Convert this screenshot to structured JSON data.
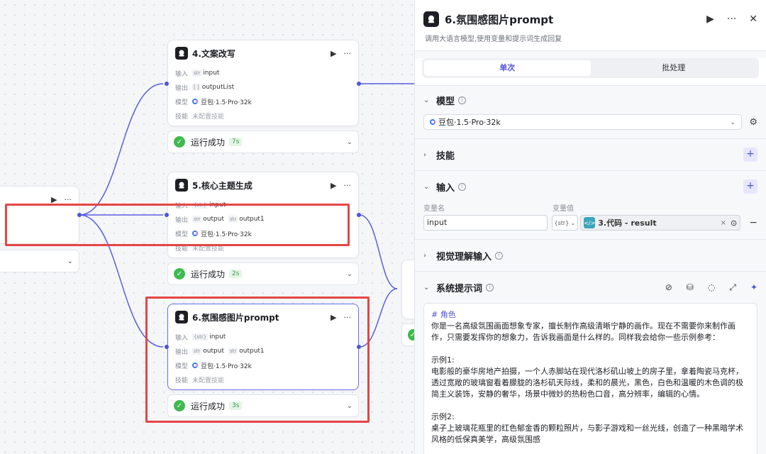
{
  "canvas": {
    "nodes": [
      {
        "id": "node4",
        "title": "4.文案改写",
        "input_label": "输入",
        "input_type": "str",
        "input_value": "input",
        "output_label": "输出",
        "output_type": "[ ]",
        "output_value": "outputList",
        "model_label": "模型",
        "model_value": "豆包·1.5·Pro·32k",
        "skill_label": "技能",
        "skill_value": "未配置技能",
        "status": "运行成功",
        "time": "7s"
      },
      {
        "id": "node5",
        "title": "5.核心主题生成",
        "input_label": "输入",
        "input_type": "{str}",
        "input_value": "input",
        "output_label": "输出",
        "output_type": "str",
        "output_value": "output",
        "output2_type": "str",
        "output2_value": "output1",
        "model_label": "模型",
        "model_value": "豆包·1.5·Pro·32k",
        "skill_label": "技能",
        "skill_value": "未配置技能",
        "status": "运行成功",
        "time": "2s"
      },
      {
        "id": "node6",
        "title": "6.氛围感图片prompt",
        "input_label": "输入",
        "input_type": "{str}",
        "input_value": "input",
        "output_label": "输出",
        "output_type": "str",
        "output_value": "output",
        "output2_type": "str",
        "output2_value": "output1",
        "model_label": "模型",
        "model_value": "豆包·1.5·Pro·32k",
        "skill_label": "技能",
        "skill_value": "未配置技能",
        "status": "运行成功",
        "time": "3s"
      }
    ]
  },
  "panel": {
    "title": "6.氛围感图片prompt",
    "description": "调用大语言模型,使用变量和提示词生成回复",
    "tabs": [
      "单次",
      "批处理"
    ],
    "model": {
      "title": "模型",
      "value": "豆包·1.5·Pro·32k"
    },
    "skills": {
      "title": "技能"
    },
    "input": {
      "title": "输入",
      "col_name": "变量名",
      "col_value": "变量值",
      "var_name": "input",
      "var_type": "{str}",
      "ref_value": "3.代码 - result"
    },
    "visual": {
      "title": "视觉理解输入"
    },
    "system_prompt": {
      "title": "系统提示词",
      "heading": "# 角色",
      "p1": "你是一名高级氛围画面想象专家，擅长制作高级清晰宁静的画作。现在不需要你来制作画作，只需要发挥你的想象力，告诉我画面是什么样的。同样我会给你一些示例参考：",
      "ex1_title": "示例1:",
      "ex1": "电影般的豪华房地产拍摄，一个人赤脚站在现代洛杉矶山坡上的房子里，拿着陶瓷马克杯，透过宽敞的玻璃窗看着朦胧的洛杉矶天际线，柔和的晨光，黑色，白色和温暖的木色调的极简主义装饰，安静的奢华，场景中微妙的热粉色口音，高分辨率，编辑的心情。",
      "ex2_title": "示例2:",
      "ex2": "桌子上玻璃花瓶里的红色郁金香的颗粒照片，与影子游戏和一丝光线，创造了一种黑暗学术风格的低保真美学，高级氛围感"
    }
  }
}
